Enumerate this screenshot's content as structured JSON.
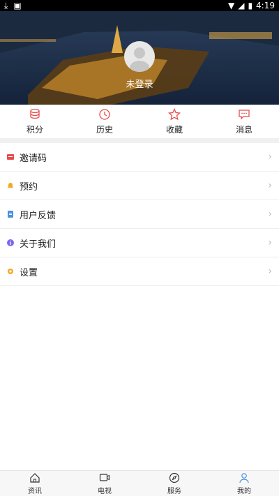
{
  "status_bar": {
    "time": "4:19"
  },
  "profile": {
    "login_text": "未登录"
  },
  "quick_actions": [
    {
      "label": "积分",
      "icon": "coins-icon"
    },
    {
      "label": "历史",
      "icon": "history-icon"
    },
    {
      "label": "收藏",
      "icon": "star-icon"
    },
    {
      "label": "消息",
      "icon": "message-icon"
    }
  ],
  "menu": [
    {
      "label": "邀请码",
      "icon": "invite-code-icon",
      "color": "#e84c4c"
    },
    {
      "label": "预约",
      "icon": "bell-icon",
      "color": "#f5a623"
    },
    {
      "label": "用户反馈",
      "icon": "feedback-icon",
      "color": "#4a90e2"
    },
    {
      "label": "关于我们",
      "icon": "info-icon",
      "color": "#7b68ee"
    },
    {
      "label": "设置",
      "icon": "gear-icon",
      "color": "#f5a623"
    }
  ],
  "tabbar": [
    {
      "label": "资讯",
      "icon": "home-icon"
    },
    {
      "label": "电视",
      "icon": "tv-icon"
    },
    {
      "label": "服务",
      "icon": "compass-icon"
    },
    {
      "label": "我的",
      "icon": "user-icon"
    }
  ],
  "colors": {
    "accent": "#e84c4c",
    "active_tab": "#4a90e2"
  }
}
